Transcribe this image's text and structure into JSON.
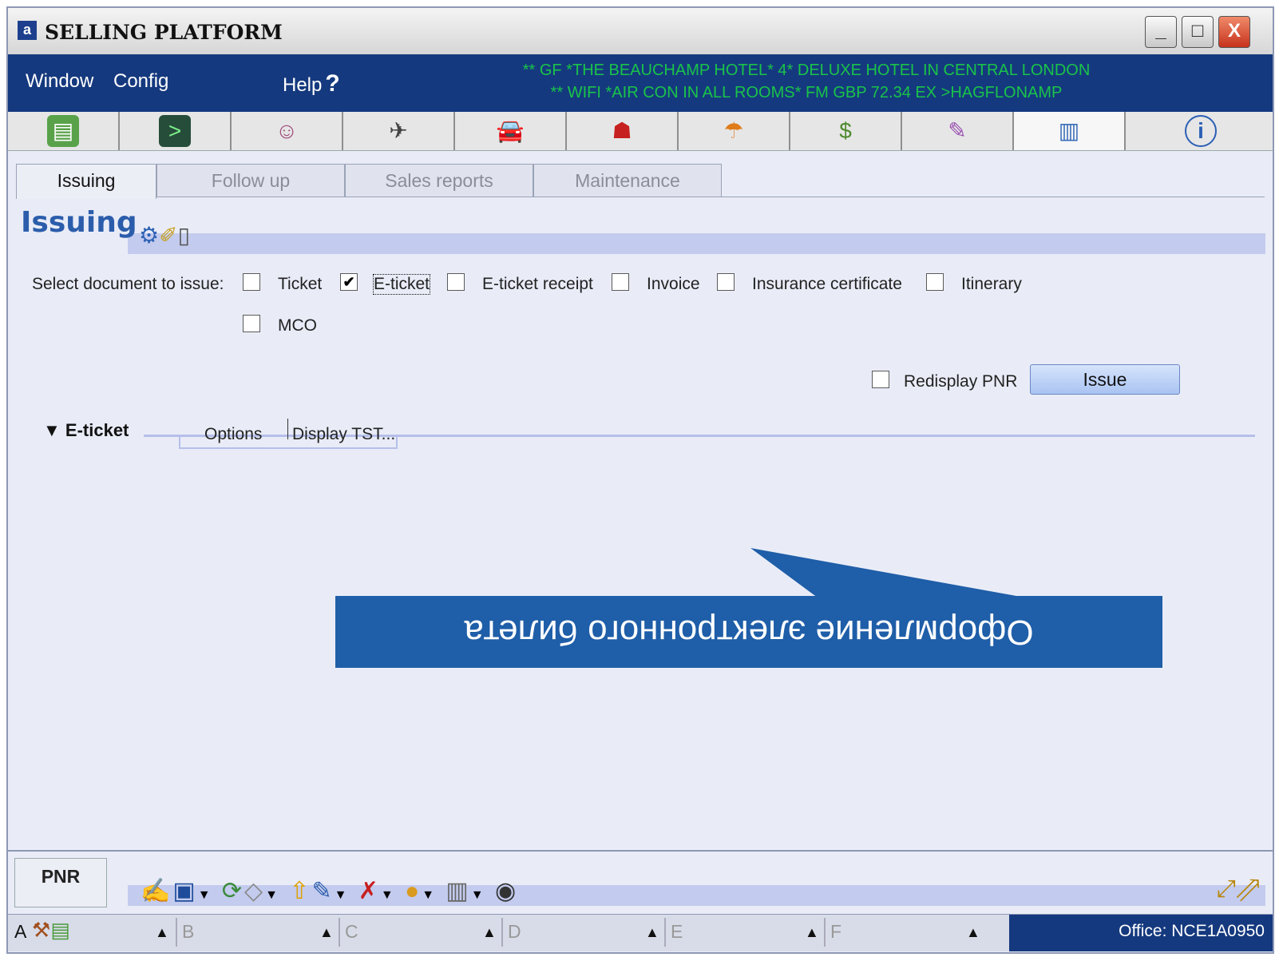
{
  "window": {
    "title": "SELLING PLATFORM",
    "controls": {
      "minimize": "_",
      "maximize": "□",
      "close": "X"
    }
  },
  "menu": {
    "items": [
      "Window",
      "Config",
      "Help"
    ],
    "help_mark": "?"
  },
  "ticker": {
    "line1": "** GF *THE BEAUCHAMP HOTEL* 4* DELUXE HOTEL IN CENTRAL LONDON",
    "line2": "** WIFI *AIR CON IN ALL ROOMS* FM GBP 72.34 EX >HAGFLONAMP"
  },
  "toolbar": {
    "icons": [
      "pnr-book-icon",
      "terminal-icon",
      "customer-profile-icon",
      "air-icon",
      "car-icon",
      "hotel-icon",
      "insurance-umbrella-icon",
      "money-icon",
      "queue-list-icon",
      "document-issue-icon",
      "info-icon"
    ],
    "active_index": 9
  },
  "tabs": [
    "Issuing",
    "Follow up",
    "Sales reports",
    "Maintenance"
  ],
  "panel": {
    "title": "Issuing",
    "select_label": "Select document to issue:",
    "options": [
      {
        "label": "Ticket",
        "checked": false
      },
      {
        "label": "E-ticket",
        "checked": true
      },
      {
        "label": "E-ticket receipt",
        "checked": false
      },
      {
        "label": "Invoice",
        "checked": false
      },
      {
        "label": "Insurance certificate",
        "checked": false
      },
      {
        "label": "Itinerary",
        "checked": false
      },
      {
        "label": "MCO",
        "checked": false
      }
    ],
    "redisplay_label": "Redisplay PNR",
    "issue_button": "Issue"
  },
  "eticket_section": {
    "header": "E-ticket",
    "subtabs": [
      "Options",
      "Display TST..."
    ]
  },
  "callout": {
    "text": "Оформление электронного билета",
    "color": "#1f5ea8"
  },
  "bottom": {
    "pnr_tab": "PNR"
  },
  "status": {
    "areas": [
      "A",
      "B",
      "C",
      "D",
      "E",
      "F"
    ],
    "office": "Office: NCE1A0950"
  }
}
